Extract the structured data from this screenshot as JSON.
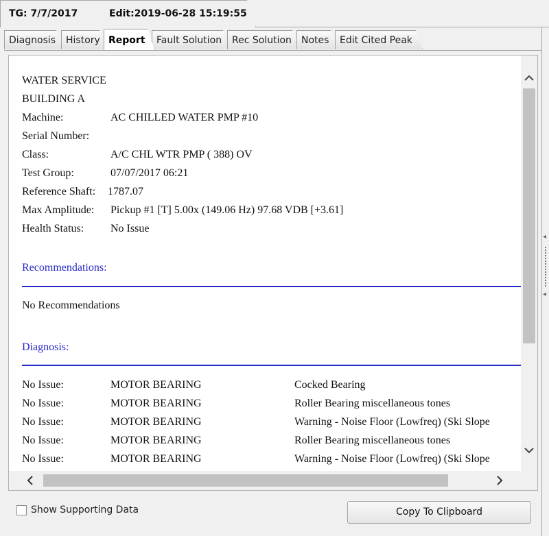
{
  "header": {
    "test_group": "TG: 7/7/2017",
    "edit": "Edit:2019-06-28 15:19:55"
  },
  "tabs": [
    {
      "label": "Diagnosis",
      "active": false
    },
    {
      "label": "History",
      "active": false
    },
    {
      "label": "Report",
      "active": true
    },
    {
      "label": "Fault Solution",
      "active": false
    },
    {
      "label": "Rec Solution",
      "active": false
    },
    {
      "label": "Notes",
      "active": false
    },
    {
      "label": "Edit Cited Peak",
      "active": false
    }
  ],
  "report": {
    "line1": "WATER SERVICE",
    "line2": "BUILDING A",
    "fields": [
      {
        "label": "Machine:",
        "value": "AC CHILLED WATER PMP #10"
      },
      {
        "label": "Serial Number:",
        "value": ""
      },
      {
        "label": "Class:",
        "value": "A/C CHL WTR PMP ( 388) OV"
      },
      {
        "label": "Test Group:",
        "value": "07/07/2017 06:21"
      },
      {
        "label": "Reference Shaft:",
        "value": "1787.07"
      },
      {
        "label": "Max Amplitude:",
        "value": "Pickup #1 [T] 5.00x (149.06 Hz) 97.68 VDB [+3.61]"
      },
      {
        "label": "Health Status:",
        "value": "No Issue"
      }
    ],
    "recommendations_heading": "Recommendations:",
    "recommendations_text": "No Recommendations",
    "diagnosis_heading": "Diagnosis:",
    "diagnosis_rows": [
      {
        "status": "No Issue:",
        "component": "MOTOR BEARING",
        "fault": "Cocked Bearing"
      },
      {
        "status": "No Issue:",
        "component": "MOTOR BEARING",
        "fault": "Roller Bearing miscellaneous tones"
      },
      {
        "status": "No Issue:",
        "component": "MOTOR BEARING",
        "fault": "Warning - Noise Floor (Lowfreq) (Ski Slope"
      },
      {
        "status": "No Issue:",
        "component": "MOTOR BEARING",
        "fault": "Roller Bearing miscellaneous tones"
      },
      {
        "status": "No Issue:",
        "component": "MOTOR BEARING",
        "fault": "Warning - Noise Floor (Lowfreq) (Ski Slope"
      }
    ]
  },
  "scrollbars": {
    "up_icon": "chevron-up-icon",
    "down_icon": "chevron-down-icon",
    "left_icon": "chevron-left-icon",
    "right_icon": "chevron-right-icon"
  },
  "footer": {
    "show_supporting_label": "Show Supporting Data",
    "show_supporting_checked": false,
    "copy_button_label": "Copy To Clipboard"
  }
}
